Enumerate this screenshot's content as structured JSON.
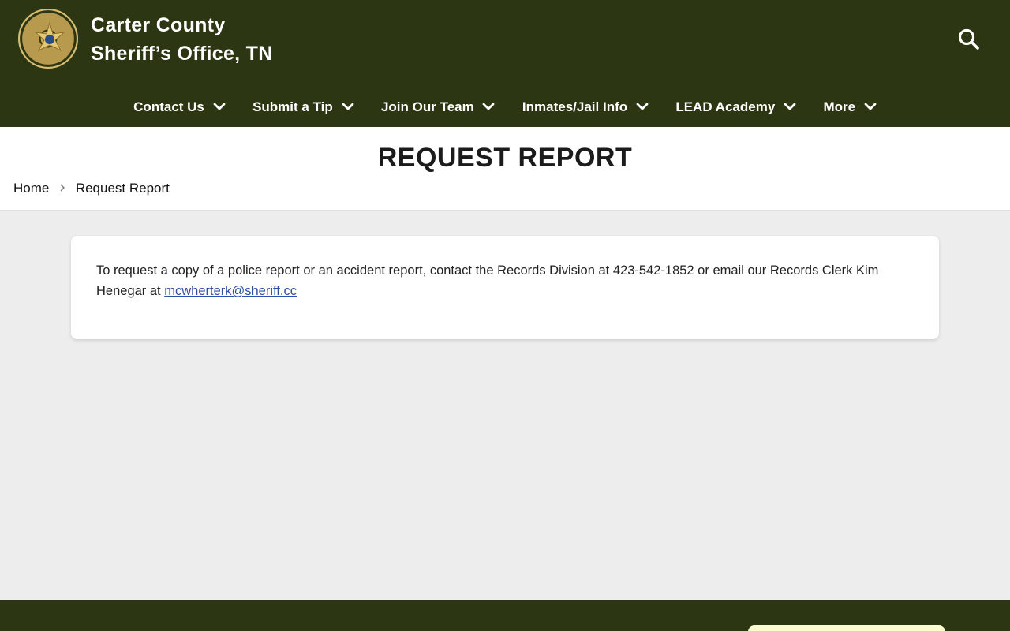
{
  "site": {
    "title_line1": "Carter County",
    "title_line2": "Sheriff’s Office, TN"
  },
  "nav": {
    "items": [
      {
        "label": "Contact Us"
      },
      {
        "label": "Submit a Tip"
      },
      {
        "label": "Join Our Team"
      },
      {
        "label": "Inmates/Jail Info"
      },
      {
        "label": "LEAD Academy"
      },
      {
        "label": "More"
      }
    ]
  },
  "page": {
    "title": "REQUEST REPORT",
    "breadcrumb": {
      "home": "Home",
      "current": "Request Report"
    }
  },
  "content": {
    "text": "To request a copy of a police report or an accident report, contact the Records Division at 423-542-1852 or email our Records Clerk Kim Henegar at ",
    "email_link": "mcwherterk@sheriff.cc"
  },
  "colors": {
    "header_bg": "#2c3613",
    "link": "#2f4ea8",
    "page_bg": "#ededed"
  },
  "icons": {
    "logo": "sheriff-badge-seal",
    "search": "search-icon",
    "dropdown": "chevron-down-icon",
    "breadcrumb_separator": "chevron-right-icon"
  }
}
